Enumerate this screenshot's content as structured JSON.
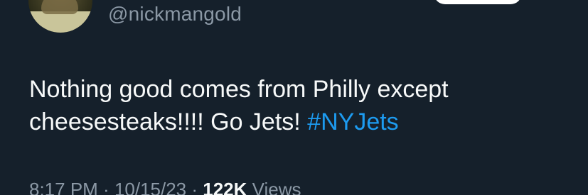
{
  "tweet": {
    "handle": "@nickmangold",
    "text_line1": "Nothing good comes from Philly except",
    "text_line2": "cheesesteaks!!!! Go Jets! ",
    "hashtag": "#NYJets",
    "time": "8:17 PM",
    "sep1": " · ",
    "date": "10/15/23",
    "sep2": " · ",
    "views_count": "122K",
    "views_label": " Views"
  }
}
